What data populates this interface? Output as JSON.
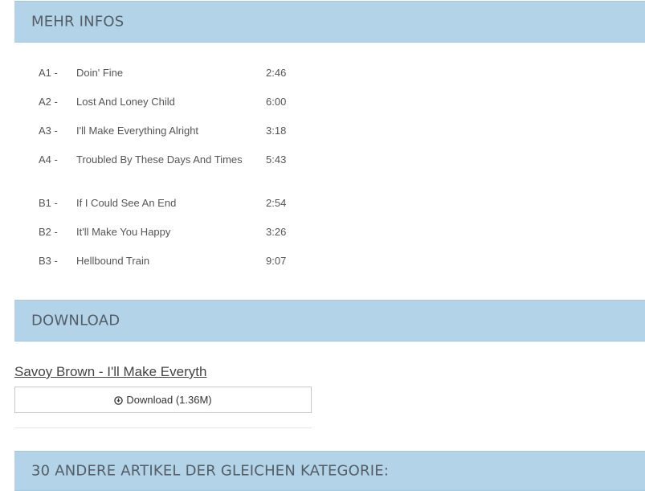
{
  "sections": {
    "info": {
      "title": "MEHR INFOS"
    },
    "download": {
      "title": "DOWNLOAD"
    },
    "related": {
      "title": "30 ANDERE ARTIKEL DER GLEICHEN KATEGORIE:"
    }
  },
  "tracks": [
    {
      "pos": "A1 -",
      "name": "Doin' Fine",
      "duration": "2:46"
    },
    {
      "pos": "A2 -",
      "name": "Lost And Loney Child",
      "duration": "6:00"
    },
    {
      "pos": "A3 -",
      "name": "I'll Make Everything Alright",
      "duration": "3:18"
    },
    {
      "pos": "A4 -",
      "name": "Troubled By These Days And Times",
      "duration": "5:43"
    },
    {
      "pos": "B1 -",
      "name": "If I Could See An End",
      "duration": "2:54"
    },
    {
      "pos": "B2 -",
      "name": "It'll Make You Happy",
      "duration": "3:26"
    },
    {
      "pos": "B3 -",
      "name": "Hellbound Train",
      "duration": "9:07"
    }
  ],
  "download": {
    "link_text": "Savoy Brown - I'll Make Everyth",
    "button_label": "Download (1.36M)",
    "button_icon": "download-circle-icon"
  },
  "colors": {
    "header_bg": "#b3d3e8",
    "header_text": "#555e66",
    "body_text": "#555555"
  }
}
